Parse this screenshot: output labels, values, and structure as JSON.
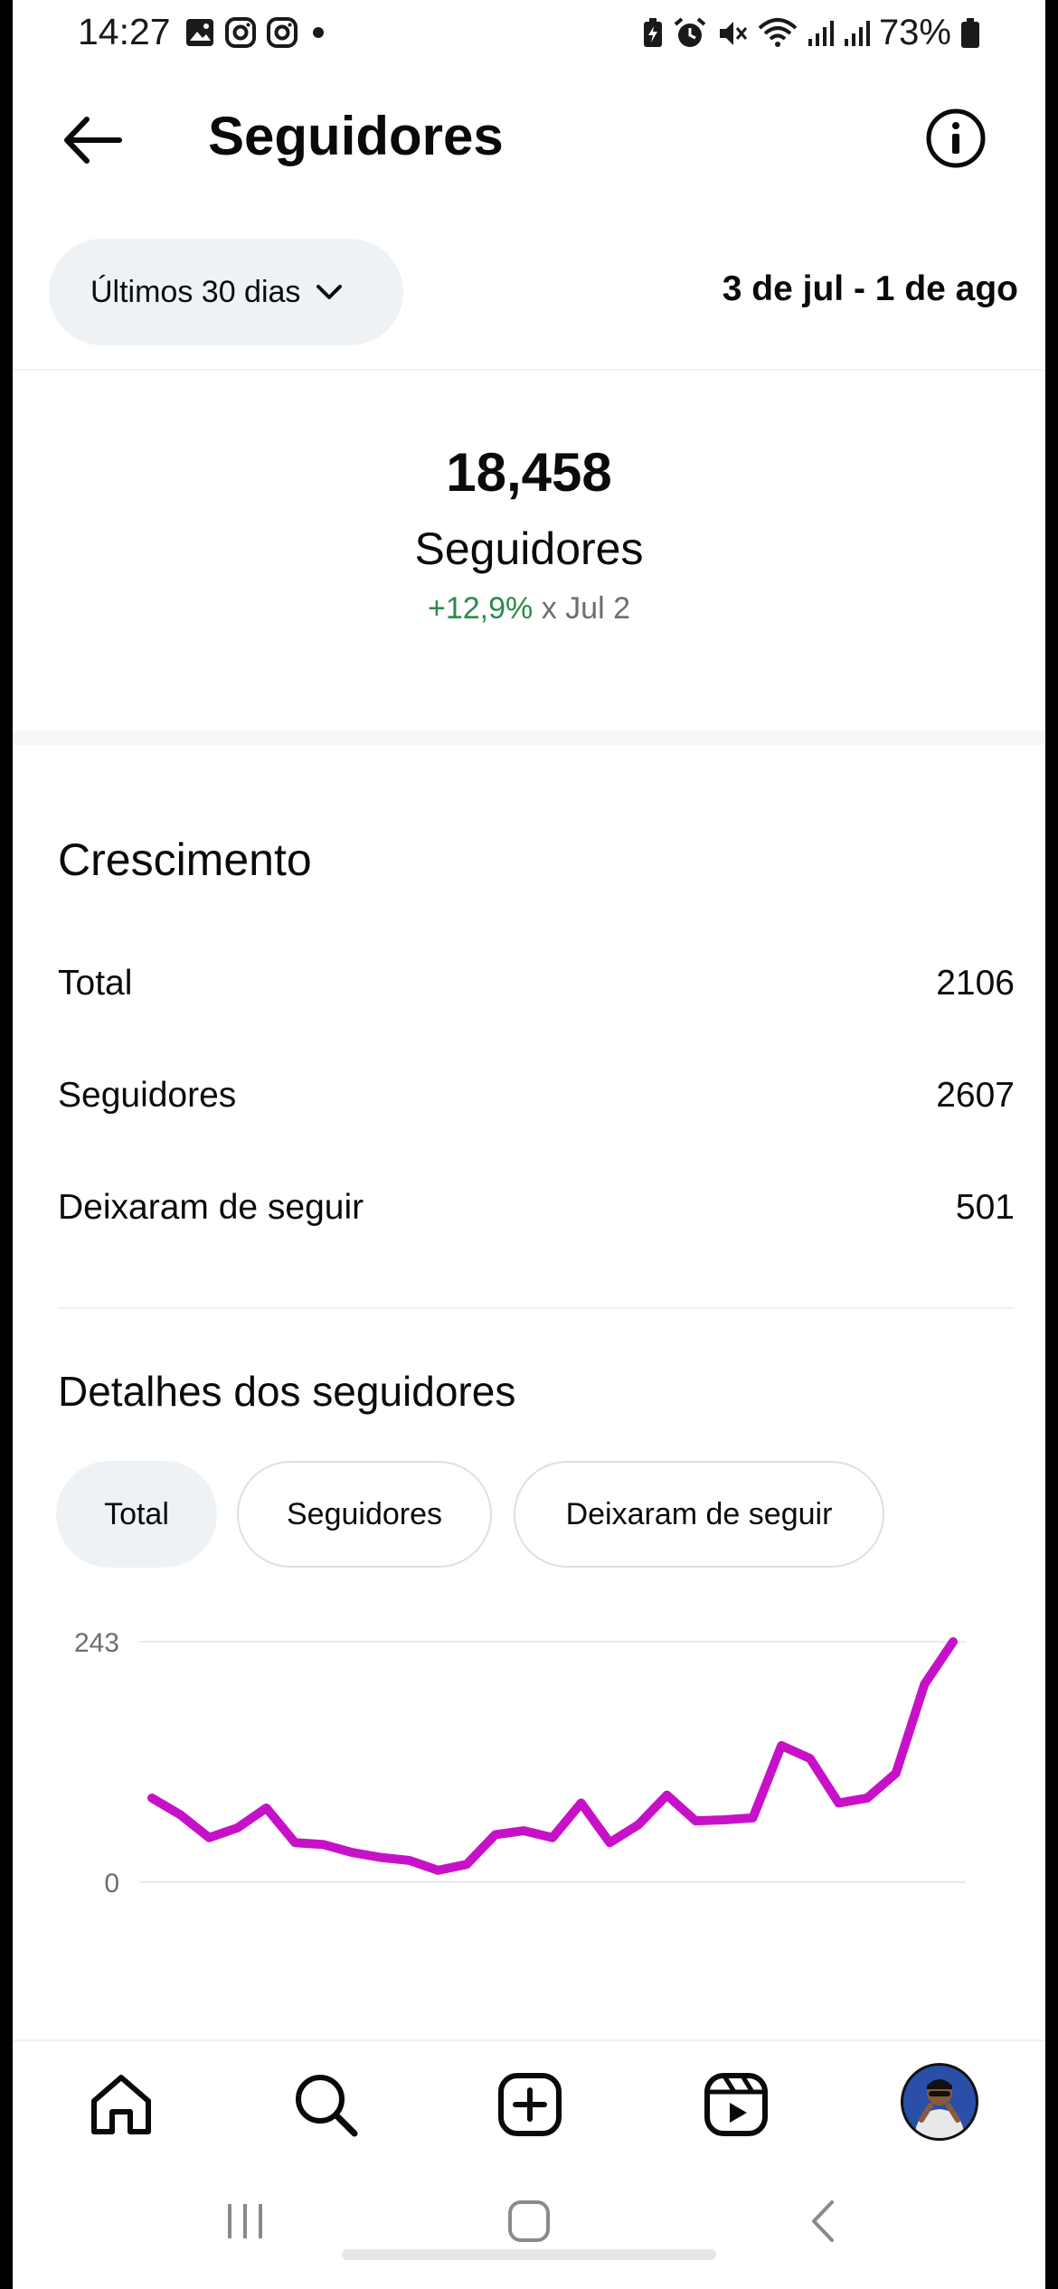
{
  "status_bar": {
    "time": "14:27",
    "battery_percent": "73%",
    "left_icons": [
      "gallery-icon",
      "instagram-icon",
      "instagram-icon",
      "notification-dot"
    ],
    "right_icons": [
      "battery-saver-icon",
      "alarm-icon",
      "mute-icon",
      "wifi-icon",
      "signal-icon",
      "signal-icon",
      "battery-icon"
    ]
  },
  "header": {
    "title": "Seguidores"
  },
  "range": {
    "selector_label": "Últimos 30 dias",
    "date_range": "3 de jul - 1 de ago"
  },
  "summary": {
    "count": "18,458",
    "label": "Seguidores",
    "change_percent": "+12,9%",
    "change_reference": "x Jul 2"
  },
  "growth": {
    "title": "Crescimento",
    "rows": [
      {
        "label": "Total",
        "value": "2106"
      },
      {
        "label": "Seguidores",
        "value": "2607"
      },
      {
        "label": "Deixaram de seguir",
        "value": "501"
      }
    ]
  },
  "details": {
    "title": "Detalhes dos seguidores",
    "tabs": [
      {
        "label": "Total",
        "active": true
      },
      {
        "label": "Seguidores",
        "active": false
      },
      {
        "label": "Deixaram de seguir",
        "active": false
      }
    ]
  },
  "colors": {
    "accent_green": "#2c8a4b",
    "chart_line": "#c711c9",
    "pill_bg": "#eff2f5"
  },
  "chart_data": {
    "type": "line",
    "ylim": [
      0,
      243
    ],
    "y_tick_labels": [
      "243",
      "0"
    ],
    "grid": true,
    "series": [
      {
        "values": [
          85,
          68,
          45,
          55,
          75,
          40,
          38,
          30,
          25,
          22,
          12,
          18,
          48,
          52,
          45,
          80,
          40,
          58,
          88,
          62,
          63,
          65,
          138,
          125,
          80,
          85,
          110,
          200,
          243
        ]
      }
    ]
  },
  "bottom_nav": {
    "items": [
      "home-icon",
      "search-icon",
      "create-icon",
      "reels-icon",
      "profile-avatar"
    ]
  }
}
